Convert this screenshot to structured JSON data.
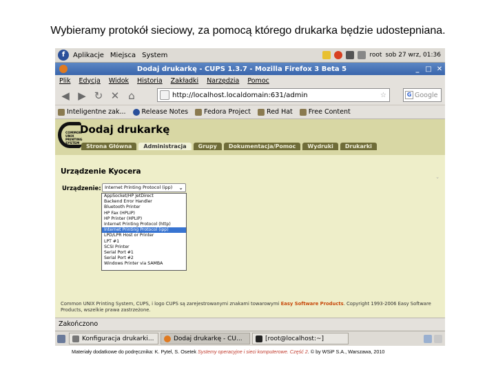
{
  "slide": {
    "title": "Wybieramy protokół sieciowy, za pomocą którego drukarka będzie udostepniana.",
    "caption_prefix": "Materiały dodatkowe do podręcznika: K. Pytel, S. Osetek",
    "caption_book": "Systemy operacyjne i sieci komputerowe. Część 2",
    "caption_suffix": ". © by WSiP S.A., Warszawa, 2010"
  },
  "gnome_panel": {
    "menus": [
      "Aplikacje",
      "Miejsca",
      "System"
    ],
    "user": "root",
    "datetime": "sob 27 wrz, 01:36"
  },
  "firefox": {
    "window_title": "Dodaj drukarkę - CUPS 1.3.7 - Mozilla Firefox 3 Beta 5",
    "menu": [
      "Plik",
      "Edycja",
      "Widok",
      "Historia",
      "Zakładki",
      "Narzędzia",
      "Pomoc"
    ],
    "url": "http://localhost.localdomain:631/admin",
    "search_placeholder": "Google",
    "bookmarks": [
      "Inteligentne zak...",
      "Release Notes",
      "Fedora Project",
      "Red Hat",
      "Free Content"
    ],
    "status": "Zakończono"
  },
  "cups": {
    "logo_text": "COMMON UNIX PRINTING SYSTEM",
    "page_title": "Dodaj drukarkę",
    "tabs": [
      "Strona Główna",
      "Administracja",
      "Grupy",
      "Dokumentacja/Pomoc",
      "Wydruki",
      "Drukarki"
    ],
    "section_title": "Urządzenie Kyocera",
    "device_label": "Urządzenie:",
    "device_selected": "Internet Printing Protocol (ipp)",
    "device_options": [
      "AppSocket/HP JetDirect",
      "Backend Error Handler",
      "Bluetooth Printer",
      "HP Fax (HPLIP)",
      "HP Printer (HPLIP)",
      "Internet Printing Protocol (http)",
      "Internet Printing Protocol (ipp)",
      "LPD/LPR Host or Printer",
      "LPT #1",
      "SCSI Printer",
      "Serial Port #1",
      "Serial Port #2",
      "Windows Printer via SAMBA"
    ],
    "footer_text_1": "Common UNIX Printing System, CUPS, i logo CUPS są zarejestrowanymi znakami towarowymi",
    "footer_org": "Easy Software Products",
    "footer_text_2": ". Copyright 1993-2006 Easy Software Products, wszelkie prawa zastrzeżone."
  },
  "taskbar": {
    "items": [
      "Konfiguracja drukarki...",
      "Dodaj drukarkę - CU...",
      "[root@localhost:~]"
    ]
  }
}
